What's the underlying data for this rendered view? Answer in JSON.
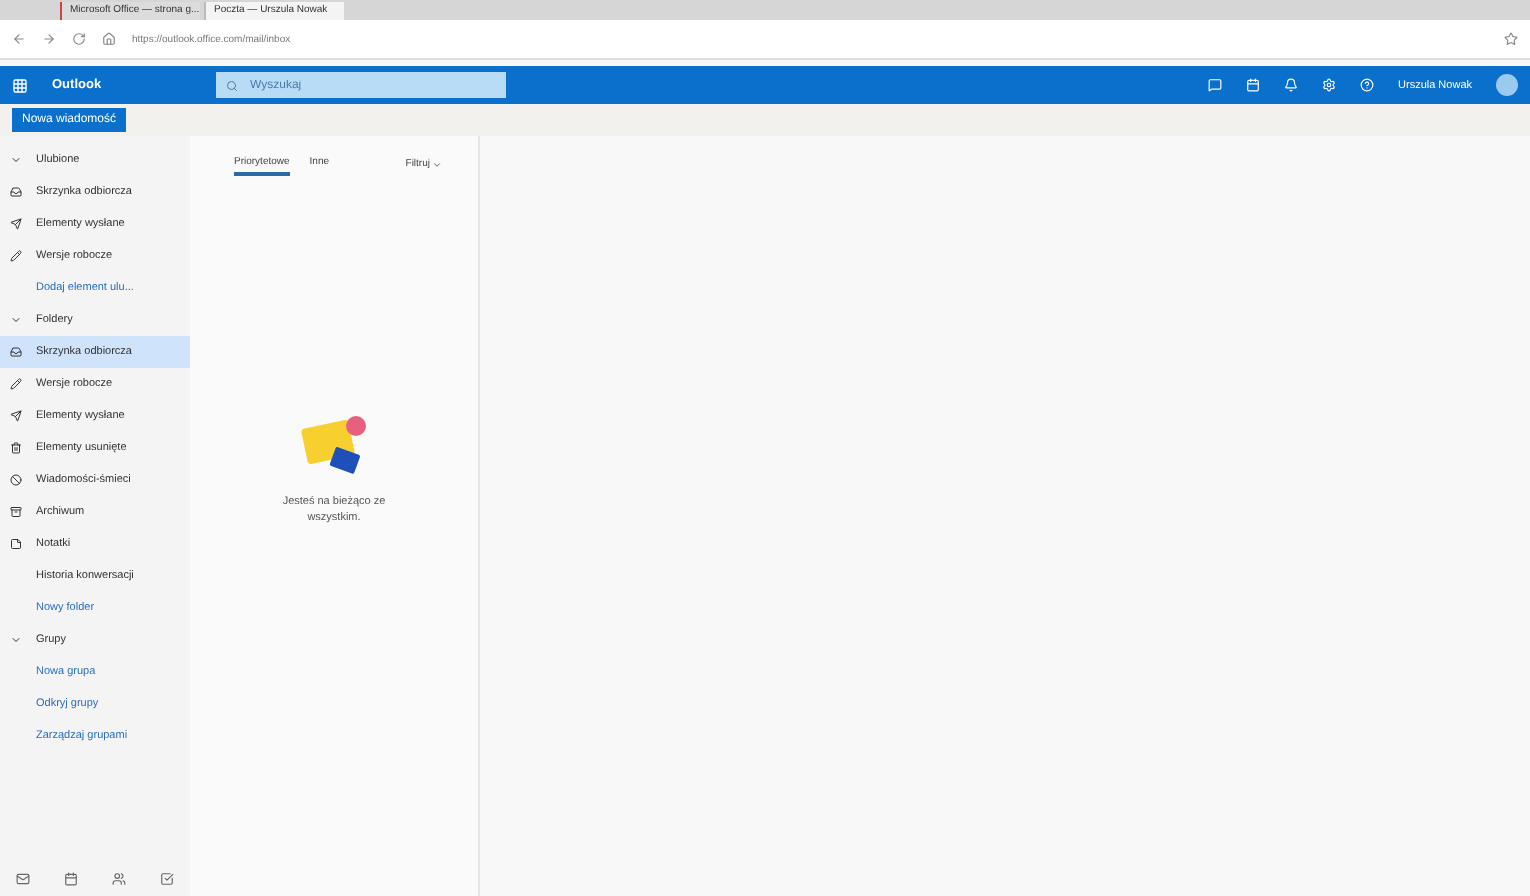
{
  "browser": {
    "tabs": [
      {
        "title": "Microsoft Office — strona g...",
        "selected": false
      },
      {
        "title": "Poczta — Urszula Nowak",
        "selected": true
      }
    ],
    "url": "https://outlook.office.com/mail/inbox"
  },
  "header": {
    "app_name": "Outlook",
    "search": {
      "placeholder": "Wyszukaj"
    },
    "user_name": "Urszula Nowak"
  },
  "new_message_button": "Nowa wiadomość",
  "sidebar": {
    "sections": [
      {
        "title": "Ulubione",
        "expanded": true,
        "items": [
          {
            "label": "Skrzynka odbiorcza",
            "kind": "inbox",
            "selected": false
          },
          {
            "label": "Elementy wysłane",
            "kind": "sent",
            "selected": false
          },
          {
            "label": "Wersje robocze",
            "kind": "drafts",
            "selected": false
          },
          {
            "label": "Dodaj element ulu...",
            "kind": "link",
            "selected": false
          }
        ]
      },
      {
        "title": "Foldery",
        "expanded": true,
        "items": [
          {
            "label": "Skrzynka odbiorcza",
            "kind": "inbox",
            "selected": true
          },
          {
            "label": "Wersje robocze",
            "kind": "drafts",
            "selected": false
          },
          {
            "label": "Elementy wysłane",
            "kind": "sent",
            "selected": false
          },
          {
            "label": "Elementy usunięte",
            "kind": "deleted",
            "selected": false
          },
          {
            "label": "Wiadomości-śmieci",
            "kind": "junk",
            "selected": false
          },
          {
            "label": "Archiwum",
            "kind": "archive",
            "selected": false
          },
          {
            "label": "Notatki",
            "kind": "notes",
            "selected": false
          },
          {
            "label": "Historia konwersacji",
            "kind": "plain",
            "selected": false
          },
          {
            "label": "Nowy folder",
            "kind": "link",
            "selected": false
          }
        ]
      },
      {
        "title": "Grupy",
        "expanded": true,
        "items": [
          {
            "label": "Nowa grupa",
            "kind": "link",
            "selected": false
          },
          {
            "label": "Odkryj grupy",
            "kind": "link",
            "selected": false
          },
          {
            "label": "Zarządzaj grupami",
            "kind": "link",
            "selected": false
          }
        ]
      }
    ]
  },
  "message_list": {
    "tabs": [
      {
        "label": "Priorytetowe",
        "selected": true
      },
      {
        "label": "Inne",
        "selected": false
      }
    ],
    "filter": "Filtruj",
    "empty_message": "Jesteś na bieżąco ze wszystkim."
  }
}
